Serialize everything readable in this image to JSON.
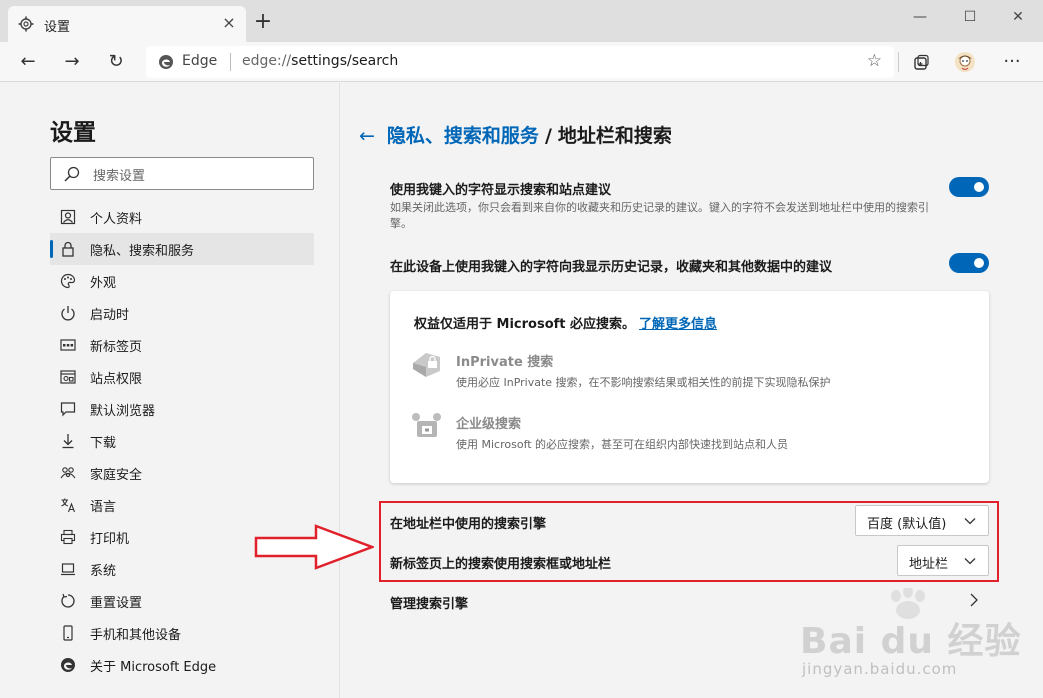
{
  "tab": {
    "title": "设置",
    "close": "×",
    "new_tab": "+"
  },
  "window": {
    "minimize": "—",
    "maximize": "☐",
    "close": "✕"
  },
  "toolbar": {
    "back": "←",
    "forward": "→",
    "refresh": "↻",
    "more": "···"
  },
  "address": {
    "site_label": "Edge",
    "url_prefix": "edge://",
    "url_rest": "settings/search",
    "favorite": "☆"
  },
  "sidebar": {
    "title": "设置",
    "search_placeholder": "搜索设置",
    "items": [
      {
        "label": "个人资料",
        "icon": "profile-icon"
      },
      {
        "label": "隐私、搜索和服务",
        "icon": "lock-icon"
      },
      {
        "label": "外观",
        "icon": "palette-icon"
      },
      {
        "label": "启动时",
        "icon": "power-icon"
      },
      {
        "label": "新标签页",
        "icon": "new-tab-page-icon"
      },
      {
        "label": "站点权限",
        "icon": "site-permissions-icon"
      },
      {
        "label": "默认浏览器",
        "icon": "default-browser-icon"
      },
      {
        "label": "下载",
        "icon": "download-icon"
      },
      {
        "label": "家庭安全",
        "icon": "family-icon"
      },
      {
        "label": "语言",
        "icon": "language-icon"
      },
      {
        "label": "打印机",
        "icon": "printer-icon"
      },
      {
        "label": "系统",
        "icon": "system-icon"
      },
      {
        "label": "重置设置",
        "icon": "reset-icon"
      },
      {
        "label": "手机和其他设备",
        "icon": "phone-icon"
      },
      {
        "label": "关于 Microsoft Edge",
        "icon": "edge-logo-icon"
      }
    ],
    "active_index": 1
  },
  "main": {
    "back_arrow": "←",
    "breadcrumb_parent": "隐私、搜索和服务",
    "breadcrumb_sep": "/",
    "breadcrumb_current": "地址栏和搜索",
    "setting1": {
      "title": "使用我键入的字符显示搜索和站点建议",
      "desc": "如果关闭此选项，你只会看到来自你的收藏夹和历史记录的建议。键入的字符不会发送到地址栏中使用的搜索引擎。",
      "enabled": true
    },
    "setting2": {
      "title": "在此设备上使用我键入的字符向我显示历史记录，收藏夹和其他数据中的建议",
      "enabled": true
    },
    "card": {
      "note": "权益仅适用于 Microsoft 必应搜索。",
      "link": "了解更多信息",
      "features": [
        {
          "title": "InPrivate 搜索",
          "desc": "使用必应 InPrivate 搜索，在不影响搜索结果或相关性的前提下实现隐私保护",
          "icon": "inprivate-search-icon"
        },
        {
          "title": "企业级搜索",
          "desc": "使用 Microsoft 的必应搜索，甚至可在组织内部快速找到站点和人员",
          "icon": "enterprise-search-icon"
        }
      ]
    },
    "engine_label": "在地址栏中使用的搜索引擎",
    "engine_value": "百度 (默认值)",
    "newtab_label": "新标签页上的搜索使用搜索框或地址栏",
    "newtab_value": "地址栏",
    "manage_label": "管理搜索引擎"
  },
  "watermark": {
    "text": "Bai du 经验",
    "sub": "jingyan.baidu.com"
  },
  "colors": {
    "accent": "#0067b8",
    "highlight": "#e0202a"
  }
}
